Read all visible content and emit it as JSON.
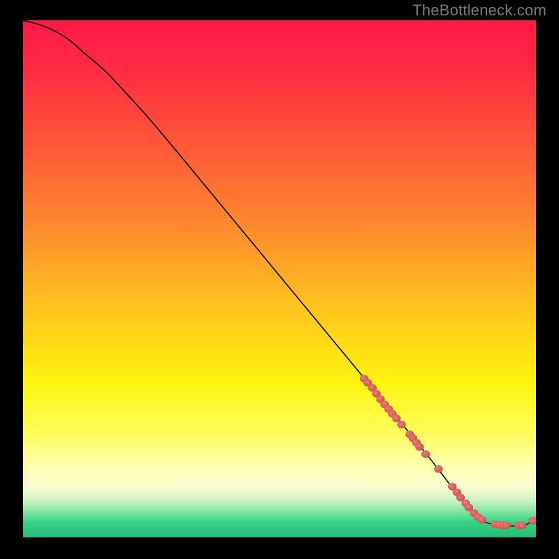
{
  "attribution": "TheBottleneck.com",
  "chart_data": {
    "type": "line",
    "title": "",
    "xlabel": "",
    "ylabel": "",
    "xlim": [
      0,
      100
    ],
    "ylim": [
      0,
      100
    ],
    "grid": false,
    "background_gradient": {
      "type": "vertical",
      "stops": [
        {
          "offset": 0.0,
          "color": "#ff1846"
        },
        {
          "offset": 0.1,
          "color": "#ff2d42"
        },
        {
          "offset": 0.25,
          "color": "#ff5a38"
        },
        {
          "offset": 0.4,
          "color": "#ff8a2d"
        },
        {
          "offset": 0.55,
          "color": "#ffc21f"
        },
        {
          "offset": 0.7,
          "color": "#fff30e"
        },
        {
          "offset": 0.8,
          "color": "#fffc5e"
        },
        {
          "offset": 0.86,
          "color": "#fffead"
        },
        {
          "offset": 0.905,
          "color": "#f6fbd0"
        },
        {
          "offset": 0.93,
          "color": "#c8f3c0"
        },
        {
          "offset": 0.952,
          "color": "#7ce39f"
        },
        {
          "offset": 0.972,
          "color": "#33d184"
        },
        {
          "offset": 1.0,
          "color": "#25bf7a"
        }
      ]
    },
    "series": [
      {
        "name": "bottleneck-curve",
        "type": "line",
        "color": "#000000",
        "stroke_width": 1.6,
        "x": [
          0,
          3,
          6,
          9,
          12,
          16,
          20,
          25,
          30,
          35,
          40,
          45,
          50,
          55,
          60,
          65,
          70,
          75,
          80,
          82,
          84,
          86,
          88,
          90,
          92,
          94,
          96,
          98,
          99.2
        ],
        "y": [
          100,
          99.2,
          98.0,
          96.2,
          93.6,
          90.2,
          86.0,
          80.5,
          74.6,
          68.6,
          62.6,
          56.6,
          50.6,
          44.6,
          38.6,
          32.6,
          26.6,
          20.6,
          14.4,
          11.8,
          9.2,
          6.6,
          4.4,
          3.0,
          2.4,
          2.2,
          2.2,
          2.4,
          3.2
        ]
      },
      {
        "name": "highlight-dots",
        "type": "scatter",
        "color": "#d9625c",
        "marker": "circle-flat",
        "x": [
          66.5,
          67.2,
          68.1,
          68.9,
          69.7,
          70.5,
          71.3,
          72.0,
          72.8,
          73.8,
          75.4,
          76.0,
          76.7,
          77.3,
          78.5,
          81.0,
          83.7,
          84.6,
          85.3,
          86.3,
          86.9,
          87.9,
          88.7,
          89.5,
          92.0,
          92.9,
          93.6,
          94.3,
          96.6,
          97.3,
          99.4
        ],
        "y": [
          30.7,
          29.9,
          28.9,
          27.8,
          26.7,
          25.7,
          24.8,
          23.9,
          23.0,
          21.8,
          19.9,
          19.2,
          18.3,
          17.5,
          16.1,
          13.2,
          9.8,
          8.7,
          7.7,
          6.6,
          5.8,
          4.7,
          3.9,
          3.4,
          2.5,
          2.4,
          2.3,
          2.3,
          2.3,
          2.3,
          3.2
        ]
      }
    ]
  }
}
